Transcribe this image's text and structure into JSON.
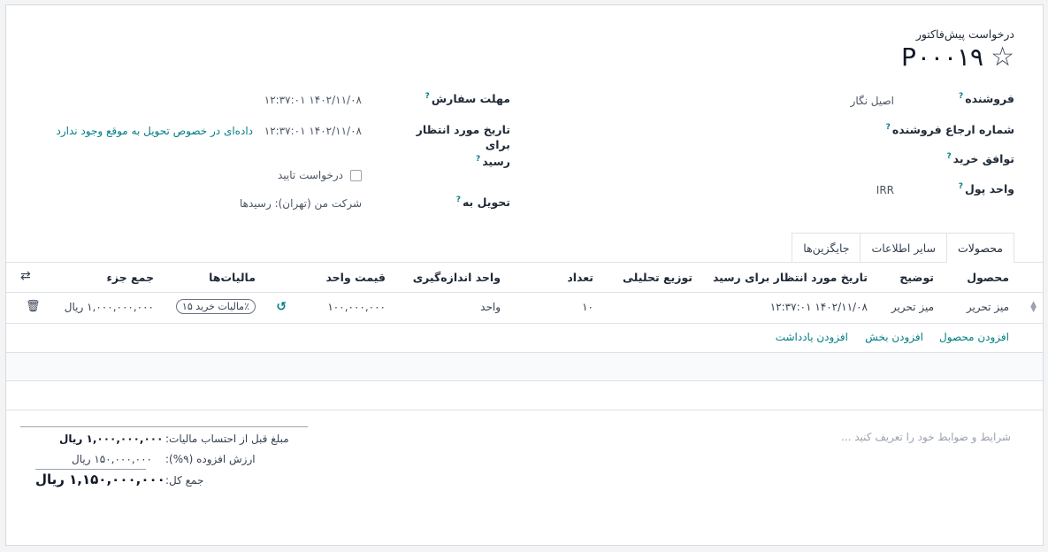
{
  "header": {
    "subtitle": "درخواست پیش‌فاکتور",
    "reference": "P۰۰۰۱۹",
    "favorite_icon": "star-icon"
  },
  "form": {
    "vendor": {
      "label": "فروشنده",
      "value": "اصیل نگار"
    },
    "vendor_reference": {
      "label": "شماره ارجاع فروشنده",
      "value": ""
    },
    "purchase_agreement": {
      "label": "توافق خرید",
      "value": ""
    },
    "currency": {
      "label": "واحد پول",
      "value": "IRR"
    },
    "order_deadline": {
      "label": "مهلت سفارش",
      "value": "۱۴۰۲/۱۱/۰۸ ۱۲:۳۷:۰۱"
    },
    "expected_arrival": {
      "label_line1": "تاریخ مورد انتظار برای",
      "label_line2": "رسید",
      "value": "۱۴۰۲/۱۱/۰۸ ۱۲:۳۷:۰۱",
      "note": "داده‌ای در خصوص تحویل به موقع وجود ندارد"
    },
    "ask_confirmation": {
      "label": "درخواست تایید",
      "checked": false
    },
    "deliver_to": {
      "label": "تحویل به",
      "value": "شرکت من (تهران): رسیدها"
    }
  },
  "tabs": [
    {
      "label": "محصولات",
      "active": true
    },
    {
      "label": "سایر اطلاعات",
      "active": false
    },
    {
      "label": "جایگزین‌ها",
      "active": false
    }
  ],
  "table": {
    "columns": {
      "product": "محصول",
      "description": "توضیح",
      "expected_date": "تاریخ مورد انتظار برای رسید",
      "analytic": "توزیع تحلیلی",
      "qty": "تعداد",
      "uom": "واحد اندازه‌گیری",
      "unit_price": "قیمت واحد",
      "taxes": "مالیات‌ها",
      "subtotal": "جمع جزء"
    },
    "rows": [
      {
        "product": "میز تحریر",
        "description": "میز تحریر",
        "expected_date": "۱۴۰۲/۱۱/۰۸ ۱۲:۳۷:۰۱",
        "analytic": "",
        "qty": "۱۰",
        "uom": "واحد",
        "unit_price": "۱۰۰,۰۰۰,۰۰۰",
        "taxes": "مالیات خرید ۱۵٪",
        "subtotal": "۱,۰۰۰,۰۰۰,۰۰۰ ریال"
      }
    ],
    "actions": {
      "add_product": "افزودن محصول",
      "add_section": "افزودن بخش",
      "add_note": "افزودن یادداشت"
    }
  },
  "terms_placeholder": "شرایط و ضوابط خود را تعریف کنید ...",
  "totals": {
    "untaxed_label": "مبلغ قبل از احتساب مالیات:",
    "untaxed_value": "۱,۰۰۰,۰۰۰,۰۰۰ ریال",
    "vat_label": "ارزش افزوده (۹%):",
    "vat_value": "۱۵۰,۰۰۰,۰۰۰ ریال",
    "total_label": "جمع کل:",
    "total_value": "۱,۱۵۰,۰۰۰,۰۰۰ ریال"
  }
}
